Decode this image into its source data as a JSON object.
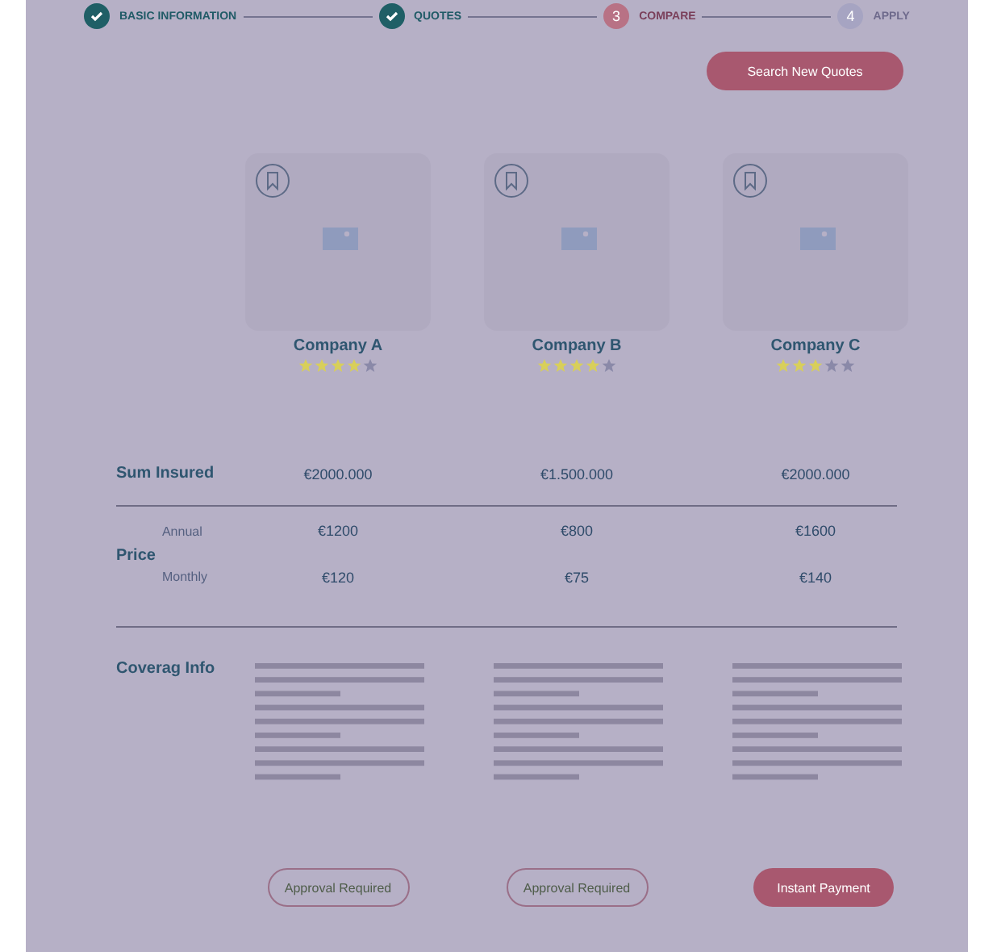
{
  "stepper": [
    {
      "label": "BASIC INFORMATION",
      "completed": true,
      "selected": false
    },
    {
      "label": "QUOTES",
      "completed": true,
      "selected": false
    },
    {
      "label": "COMPARE",
      "completed": false,
      "selected": true,
      "number": "3"
    },
    {
      "label": "APPLY",
      "completed": false,
      "selected": false,
      "number": "4"
    }
  ],
  "search_button": "Search New Quotes",
  "companies": [
    {
      "name": "Company A",
      "stars": 4,
      "sum_insured": "€2000.000",
      "annual": "€1200",
      "monthly": "€120",
      "action": {
        "label": "Approval Required",
        "kind": "outline"
      }
    },
    {
      "name": "Company B",
      "stars": 4,
      "sum_insured": "€1.500.000",
      "annual": "€800",
      "monthly": "€75",
      "action": {
        "label": "Approval Required",
        "kind": "outline"
      }
    },
    {
      "name": "Company C",
      "stars": 3,
      "sum_insured": "€2000.000",
      "annual": "€1600",
      "monthly": "€140",
      "action": {
        "label": "Instant Payment",
        "kind": "filled"
      }
    }
  ],
  "row_labels": {
    "sum_insured": "Sum Insured",
    "price": "Price",
    "annual": "Annual",
    "monthly": "Monthly",
    "coverage": "Coverag Info"
  }
}
